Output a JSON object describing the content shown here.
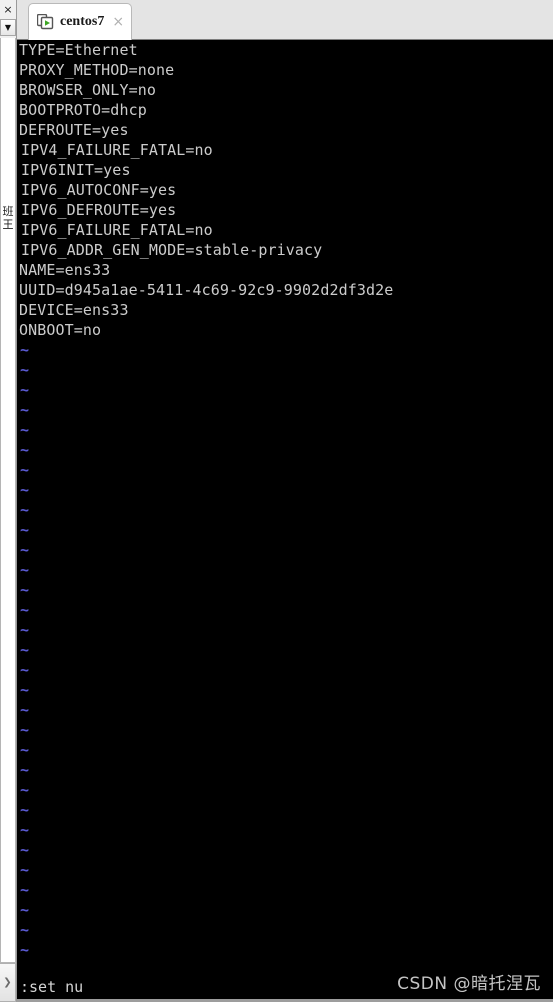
{
  "sidebar": {
    "close_icon": "×",
    "dropdown_icon": "▼",
    "vertical_label": "班王",
    "expand_icon": "❯"
  },
  "tabstrip": {
    "tab": {
      "label": "centos7",
      "icon": "vm-power-icon",
      "close_icon": "×"
    }
  },
  "terminal": {
    "lines": [
      {
        "text": "TYPE=Ethernet",
        "indent": false
      },
      {
        "text": "PROXY_METHOD=none",
        "indent": false
      },
      {
        "text": "BROWSER_ONLY=no",
        "indent": false
      },
      {
        "text": "BOOTPROTO=dhcp",
        "indent": false
      },
      {
        "text": "DEFROUTE=yes",
        "indent": false
      },
      {
        "text": "IPV4_FAILURE_FATAL=no",
        "indent": true
      },
      {
        "text": "IPV6INIT=yes",
        "indent": true
      },
      {
        "text": "IPV6_AUTOCONF=yes",
        "indent": true
      },
      {
        "text": "IPV6_DEFROUTE=yes",
        "indent": true
      },
      {
        "text": "IPV6_FAILURE_FATAL=no",
        "indent": true
      },
      {
        "text": "IPV6_ADDR_GEN_MODE=stable-privacy",
        "indent": true
      },
      {
        "text": "NAME=ens33",
        "indent": false
      },
      {
        "text": "UUID=d945a1ae-5411-4c69-92c9-9902d2df3d2e",
        "indent": false
      },
      {
        "text": "DEVICE=ens33",
        "indent": false
      },
      {
        "text": "ONBOOT=no",
        "indent": false
      }
    ],
    "tilde": "~",
    "empty_line_count": 31,
    "command_line": ":set nu",
    "watermark": "CSDN @暗托涅瓦",
    "colors": {
      "background": "#000000",
      "foreground": "#cccccc",
      "tilde": "#5a5ad2"
    }
  }
}
